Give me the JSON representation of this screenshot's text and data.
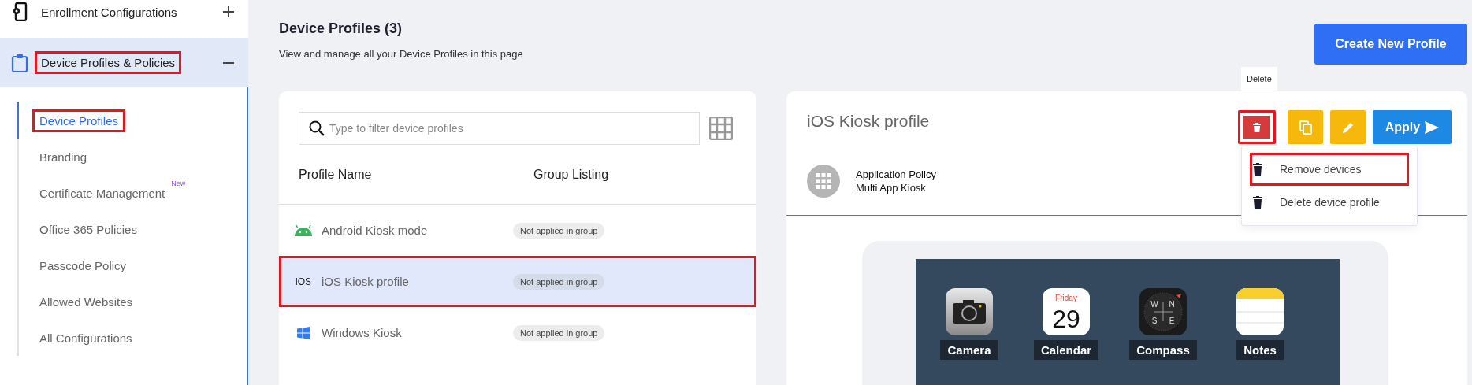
{
  "sidebar": {
    "sections": [
      {
        "label": "Enrollment Configurations",
        "kind": "enrollment",
        "expanded": false,
        "selected": false,
        "highlighted": false
      },
      {
        "label": "Device Profiles & Policies",
        "kind": "profiles",
        "expanded": true,
        "selected": true,
        "highlighted": true,
        "children": [
          {
            "label": "Device Profiles",
            "selected": true,
            "highlighted": true
          },
          {
            "label": "Branding",
            "selected": false,
            "highlighted": false
          },
          {
            "label": "Certificate Management",
            "badge": "New",
            "selected": false,
            "highlighted": false
          },
          {
            "label": "Office 365 Policies",
            "selected": false,
            "highlighted": false
          },
          {
            "label": "Passcode Policy",
            "selected": false,
            "highlighted": false
          },
          {
            "label": "Allowed Websites",
            "selected": false,
            "highlighted": false
          },
          {
            "label": "All Configurations",
            "selected": false,
            "highlighted": false
          }
        ]
      }
    ]
  },
  "page": {
    "title": "Device Profiles (3)",
    "subtitle": "View and manage all your Device Profiles in this page",
    "create_button": "Create New Profile"
  },
  "profiles": {
    "search": {
      "placeholder": "Type to filter device profiles"
    },
    "columns": [
      "Profile Name",
      "Group Listing"
    ],
    "rows": [
      {
        "kind": "android",
        "name": "Android Kiosk mode",
        "group": "Not applied in group",
        "selected": false,
        "highlighted": false
      },
      {
        "kind": "ios",
        "icon_text": "iOS",
        "name": "iOS Kiosk profile",
        "group": "Not applied in group",
        "selected": true,
        "highlighted": true
      },
      {
        "kind": "windows",
        "name": "Windows Kiosk",
        "group": "Not applied in group",
        "selected": false,
        "highlighted": false
      }
    ]
  },
  "detail": {
    "title": "iOS Kiosk profile",
    "actions": [
      {
        "kind": "delete",
        "tooltip": "Delete",
        "highlighted": true
      },
      {
        "kind": "copy",
        "highlighted": false
      },
      {
        "kind": "edit",
        "highlighted": false
      },
      {
        "kind": "apply",
        "label": "Apply",
        "highlighted": false
      }
    ],
    "menu": [
      {
        "label": "Remove devices",
        "highlighted": true
      },
      {
        "label": "Delete device profile",
        "highlighted": false
      }
    ],
    "policy": {
      "type": "Application Policy",
      "mode": "Multi App Kiosk"
    },
    "apps": [
      {
        "kind": "camera",
        "label": "Camera"
      },
      {
        "kind": "calendar",
        "label": "Calendar",
        "day": "Friday",
        "date": "29"
      },
      {
        "kind": "compass",
        "label": "Compass",
        "letters": [
          "W",
          "N",
          "S",
          "E"
        ]
      },
      {
        "kind": "notes",
        "label": "Notes"
      }
    ]
  }
}
